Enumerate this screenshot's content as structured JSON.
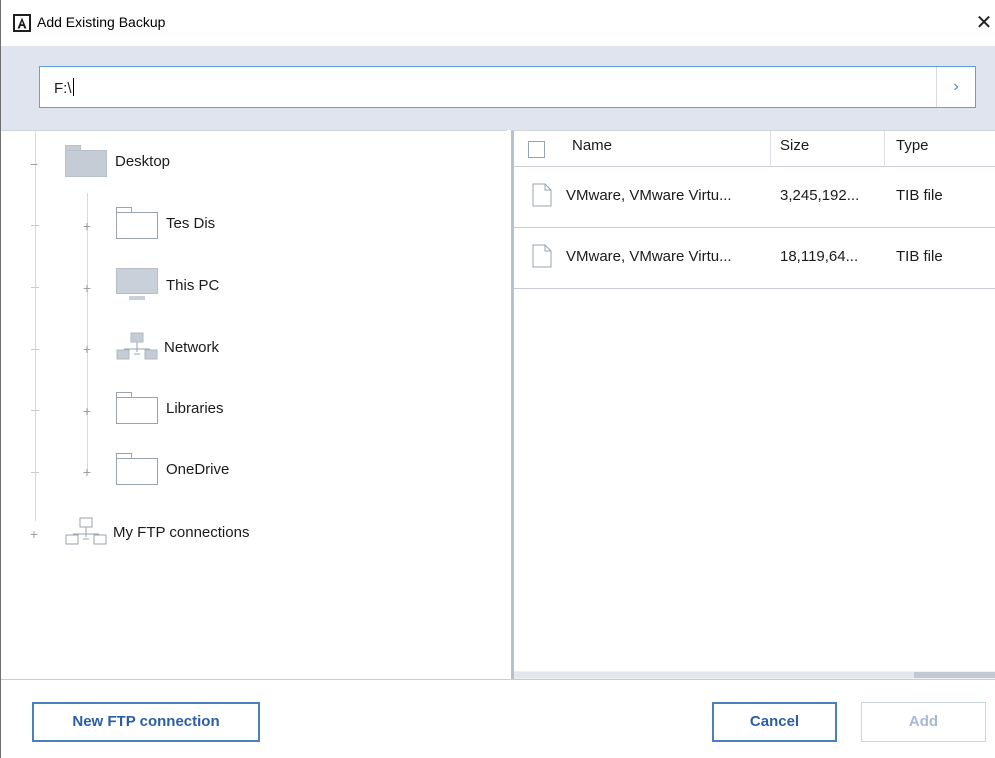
{
  "window": {
    "title": "Add Existing Backup",
    "close_glyph": "✕",
    "app_icon": "acronis-icon"
  },
  "path": {
    "value": "F:\\",
    "go_glyph": "›"
  },
  "tree": {
    "items": [
      {
        "label": "Desktop",
        "icon": "folder-icon",
        "expander": "−"
      },
      {
        "label": "Tes Dis",
        "icon": "folder-icon",
        "expander": "+"
      },
      {
        "label": "This PC",
        "icon": "computer-icon",
        "expander": "+"
      },
      {
        "label": "Network",
        "icon": "network-icon",
        "expander": "+"
      },
      {
        "label": "Libraries",
        "icon": "folder-icon",
        "expander": "+"
      },
      {
        "label": "OneDrive",
        "icon": "folder-icon",
        "expander": "+"
      },
      {
        "label": "My FTP connections",
        "icon": "ftp-connections-icon",
        "expander": "+"
      }
    ]
  },
  "list": {
    "columns": [
      "Name",
      "Size",
      "Type"
    ],
    "rows": [
      {
        "name": "VMware, VMware Virtu...",
        "size": "3,245,192...",
        "type": "TIB file"
      },
      {
        "name": "VMware, VMware Virtu...",
        "size": "18,119,64...",
        "type": "TIB file"
      }
    ]
  },
  "footer": {
    "new_ftp_label": "New FTP connection",
    "cancel_label": "Cancel",
    "add_label": "Add"
  },
  "colors": {
    "accent": "#2a5ea6",
    "path_band": "#dfe4ee",
    "disabled": "#a7b9d6"
  }
}
